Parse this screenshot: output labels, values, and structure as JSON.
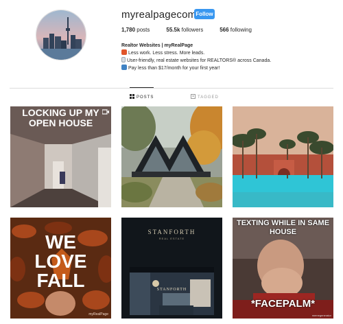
{
  "profile": {
    "username": "myrealpagecom",
    "follow_label": "Follow",
    "stats": [
      {
        "value": "1,780",
        "label": " posts"
      },
      {
        "value": "55.5k",
        "label": " followers"
      },
      {
        "value": "566",
        "label": " following"
      }
    ],
    "bio": {
      "name": "Realtor Websites | myRealPage",
      "lines": [
        "Less work. Less stress. More leads.",
        "User-friendly, real estate websites for REALTORS® across Canada.",
        "Pay less than $17/month for your first year!"
      ]
    }
  },
  "tabs": [
    {
      "label": "POSTS",
      "icon": "grid-icon",
      "active": true
    },
    {
      "label": "TAGGED",
      "icon": "tag-icon",
      "active": false
    }
  ],
  "posts": {
    "post1": {
      "text_line1": "LOCKING UP MY",
      "text_line2": "OPEN HOUSE",
      "icon": "video-icon"
    },
    "post4": {
      "text_line1": "WE",
      "text_line2": "LOVE",
      "text_line3": "FALL",
      "watermark": "myRealPage"
    },
    "post5": {
      "logo": "STANFORTH",
      "logo_sub": "REAL ESTATE",
      "screen_logo": "STANFORTH"
    },
    "post6": {
      "text_top_line1": "TEXTING WHILE IN SAME",
      "text_top_line2": "HOUSE",
      "text_bottom": "*FACEPALM*",
      "watermark": "memegenerator"
    }
  },
  "colors": {
    "follow": "#3897f0",
    "text": "#262626",
    "divider": "#dbdbdb"
  }
}
